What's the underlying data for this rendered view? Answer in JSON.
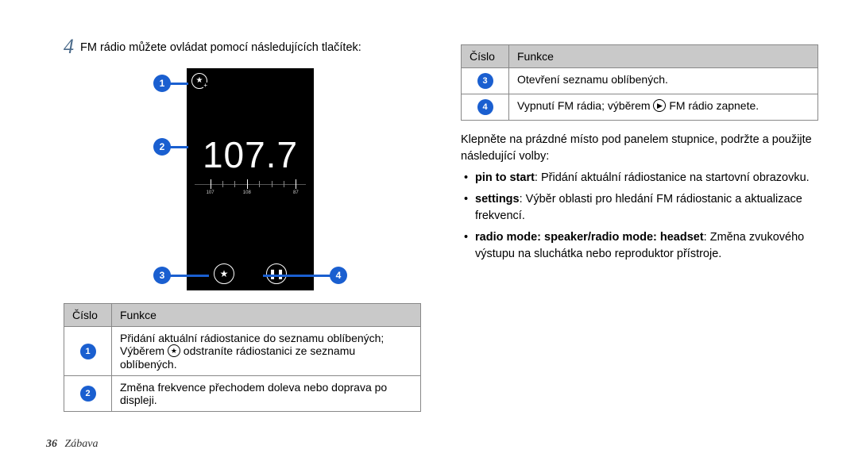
{
  "step": {
    "number": "4",
    "text": "FM rádio můžete ovládat pomocí následujících tlačítek:"
  },
  "radio": {
    "frequency": "107.7",
    "ticks": [
      "107",
      "108",
      "87"
    ]
  },
  "table_left": {
    "head": {
      "c1": "Číslo",
      "c2": "Funkce"
    },
    "rows": [
      {
        "n": "1",
        "text_before": "Přidání aktuální rádiostanice do seznamu oblíbených; Výběrem ",
        "icon": "star",
        "text_after": " odstraníte rádiostanici ze seznamu oblíbených."
      },
      {
        "n": "2",
        "text": "Změna frekvence přechodem doleva nebo doprava po displeji."
      }
    ]
  },
  "table_right": {
    "head": {
      "c1": "Číslo",
      "c2": "Funkce"
    },
    "rows": [
      {
        "n": "3",
        "text": "Otevření seznamu oblíbených."
      },
      {
        "n": "4",
        "text_before": "Vypnutí FM rádia; výběrem ",
        "icon": "play",
        "text_after": " FM rádio zapnete."
      }
    ]
  },
  "para": "Klepněte na prázdné místo pod panelem stupnice, podržte a použijte následující volby:",
  "options": [
    {
      "bold": "pin to start",
      "rest": ": Přidání aktuální rádiostanice na startovní obrazovku."
    },
    {
      "bold": "settings",
      "rest": ": Výběr oblasti pro hledání FM rádiostanic a aktualizace frekvencí."
    },
    {
      "bold": "radio mode: speaker/radio mode: headset",
      "rest": ": Změna zvukového výstupu na sluchátka nebo reproduktor přístroje."
    }
  ],
  "footer": {
    "page": "36",
    "section": "Zábava"
  }
}
